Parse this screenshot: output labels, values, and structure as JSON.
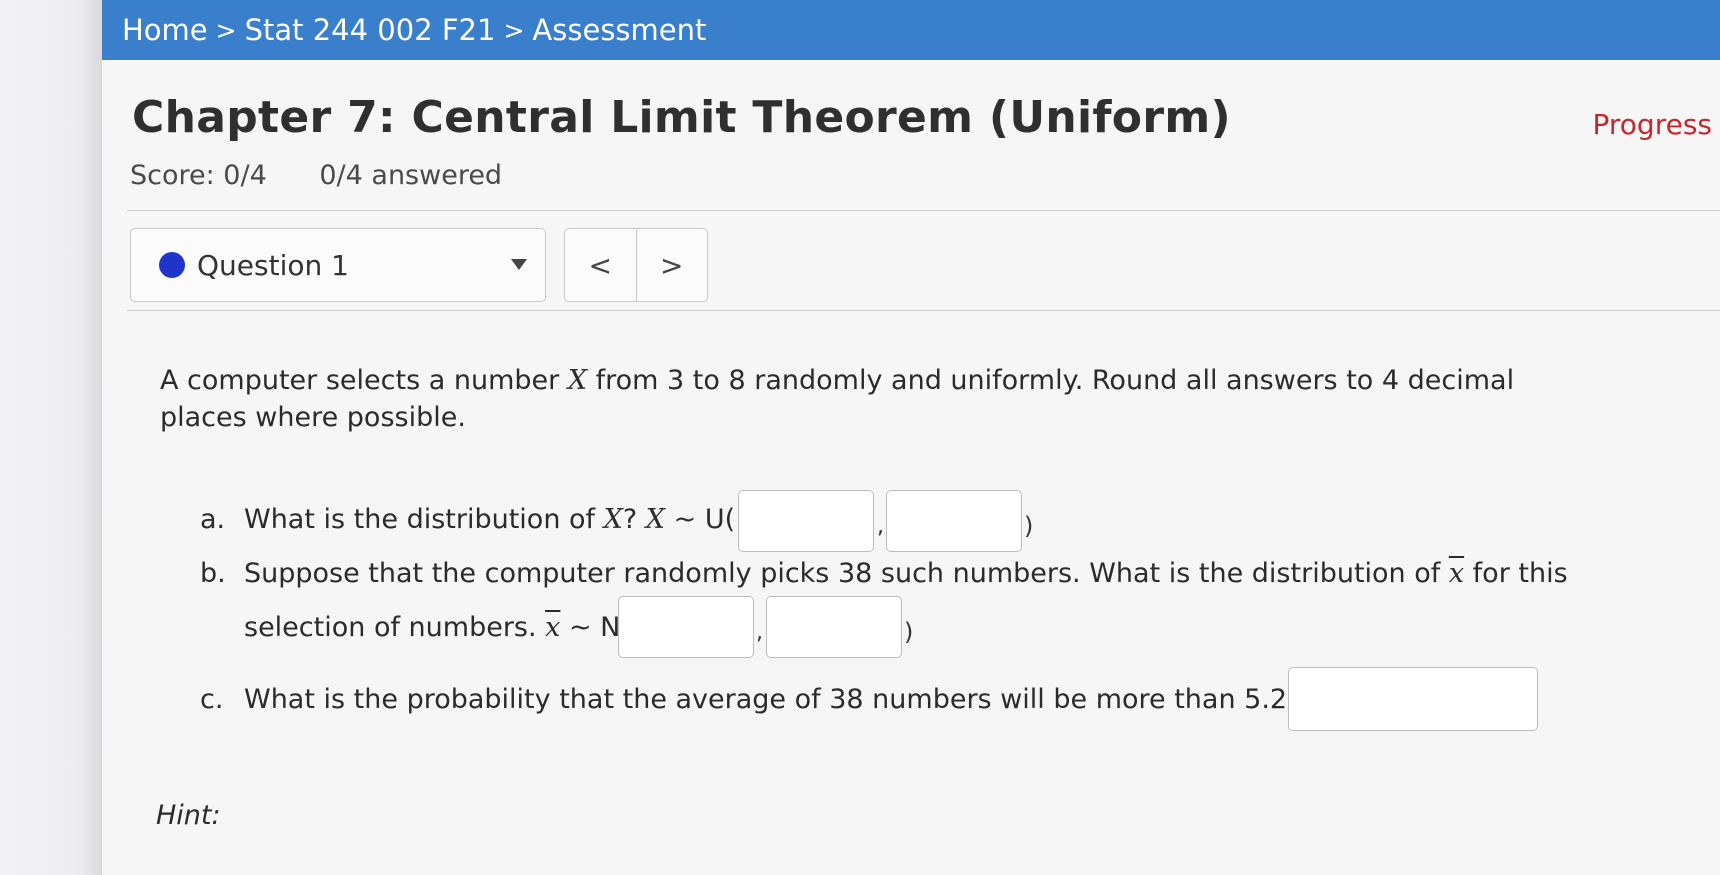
{
  "breadcrumb": {
    "home": "Home",
    "course": "Stat 244 002 F21",
    "current": "Assessment",
    "separator": ">"
  },
  "header": {
    "title": "Chapter 7: Central Limit Theorem (Uniform)",
    "progress_link": "Progress",
    "score": "Score: 0/4",
    "answered": "0/4 answered"
  },
  "question_nav": {
    "selected": "Question 1",
    "prev_glyph": "<",
    "next_glyph": ">"
  },
  "question": {
    "intro_before": "A computer selects a number ",
    "intro_var": "X",
    "intro_after": " from 3 to 8 randomly and uniformly. Round all answers to 4 decimal places where possible.",
    "part_a": {
      "letter": "a.",
      "text": "What is the distribution of ",
      "var1": "X",
      "q": "?",
      "var2": "X",
      "dist": " ~ U(",
      "comma": ",",
      "close": ")"
    },
    "part_b": {
      "letter": "b.",
      "line1_before": "Suppose that the computer randomly picks 38 such numbers.  What is the distribution of ",
      "xbar": "x",
      "line1_after": " for this",
      "line2_before": "selection of numbers. ",
      "dist": " ~ N(",
      "comma": ",",
      "close": ")"
    },
    "part_c": {
      "letter": "c.",
      "text": "What is the probability that the average of 38 numbers will be more than 5.2?"
    },
    "hint_label": "Hint:"
  },
  "colors": {
    "breadcrumb_bg": "#3a7fcc",
    "progress_link": "#c4282f",
    "status_dot": "#1f35c9"
  }
}
